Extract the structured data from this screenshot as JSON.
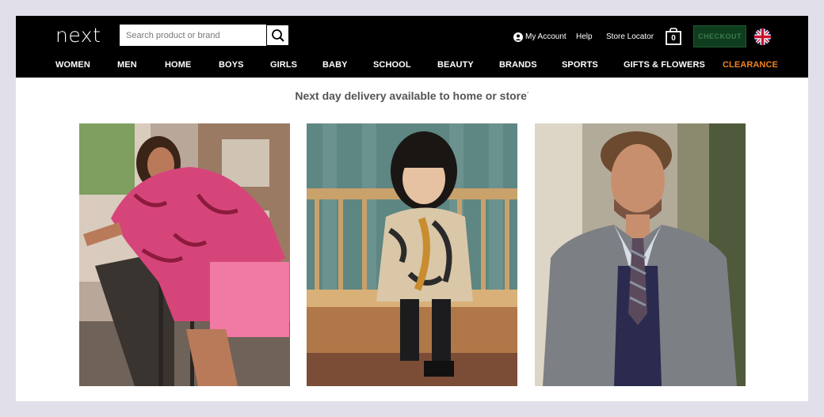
{
  "header": {
    "logo": "next",
    "search": {
      "placeholder": "Search product or brand"
    },
    "my_account": "My Account",
    "help": "Help",
    "store_locator": "Store Locator",
    "bag_count": "0",
    "checkout": "CHECKOUT",
    "region_icon": "uk-flag-icon"
  },
  "nav": {
    "items": [
      {
        "label": "WOMEN"
      },
      {
        "label": "MEN"
      },
      {
        "label": "HOME"
      },
      {
        "label": "BOYS"
      },
      {
        "label": "GIRLS"
      },
      {
        "label": "BABY"
      },
      {
        "label": "SCHOOL"
      },
      {
        "label": "BEAUTY"
      },
      {
        "label": "BRANDS"
      },
      {
        "label": "SPORTS"
      },
      {
        "label": "GIFTS & FLOWERS"
      },
      {
        "label": "CLEARANCE",
        "color": "#f0821e"
      }
    ]
  },
  "promo": {
    "text": "Next day delivery available to home or store",
    "mark": "*"
  },
  "colors": {
    "header_bg": "#000000",
    "checkout_bg": "#0e3d1e",
    "clearance": "#f0821e",
    "page_bg": "#e1e0ea"
  }
}
